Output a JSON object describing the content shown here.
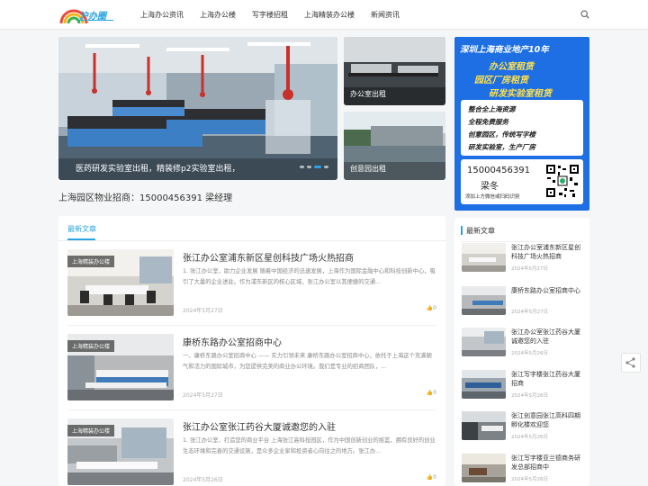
{
  "header": {
    "logo_text": "沪办圈",
    "nav": [
      "上海办公资讯",
      "上海办公楼",
      "写字楼招租",
      "上海精装办公楼",
      "新闻资讯"
    ]
  },
  "slider": {
    "caption": "医药研发实验室出租，精装修p2实验室出租，"
  },
  "side_cards": [
    {
      "label": "办公室出租"
    },
    {
      "label": "创意园出租"
    }
  ],
  "ad": {
    "headline": "深圳上海商业地产10年",
    "lines": [
      "办公室租赁",
      "园区厂房租赁",
      "研发实验室租赁"
    ],
    "body": [
      "整合全上海资源",
      "全程免费服务",
      "创意园区，传统写字楼",
      "研发实验室，生产厂房"
    ],
    "phone": "15000456391",
    "name": "梁冬",
    "wechat_hint": "添加上方微信或扫码识别"
  },
  "contact": "上海园区物业招商：15000456391 梁经理",
  "main": {
    "tab": "最新文章",
    "posts": [
      {
        "tag": "上海精装办公楼",
        "title": "张江办公室浦东新区星创科技广场火热招商",
        "excerpt": "1. 张江办公室，助力企业发展 随着中国经济的迅速发展，上海作为国际金融中心和科技创新中心，吸引了大量的企业进驻。作为浦东新区的核心区域，张江办公室以其便捷的交通...",
        "date": "2024年5月27日",
        "likes": "0"
      },
      {
        "tag": "上海精装办公楼",
        "title": "康桥东路办公室招商中心",
        "excerpt": "一、康桥东路办公室招商中心 —— 实力引领未来 康桥东路办公室招商中心，依托于上海这个充满朝气和活力的国际城市，为您提供完美的商业办公环境。我们是专业的招商团队，...",
        "date": "2024年5月27日",
        "likes": "0"
      },
      {
        "tag": "上海精装办公楼",
        "title": "张江办公室张江药谷大厦诚邀您的入驻",
        "excerpt": "1. 张江办公室，打造您的商业平台 上海张江高科技园区，作为中国创新创业的摇篮，拥有良好的创业生态环境和完善的交通设施，是众多企业家和投资者心向往之的地方。张江办...",
        "date": "2024年5月26日",
        "likes": "0"
      }
    ]
  },
  "sidebar": {
    "title": "最新文章",
    "items": [
      {
        "title": "张江办公室浦东新区星创科技广场火热招商",
        "date": "2024年5月27日"
      },
      {
        "title": "康桥东路办公室招商中心",
        "date": "2024年5月27日"
      },
      {
        "title": "张江办公室张江药谷大厦诚邀您的入驻",
        "date": "2024年5月26日"
      },
      {
        "title": "张江写字楼张江药谷大厦招商",
        "date": "2024年5月26日"
      },
      {
        "title": "张江创意园张江高科四期孵化楼欢迎您",
        "date": "2024年5月26日"
      },
      {
        "title": "张江写字楼亚兰德商务研发总部招商中",
        "date": "2024年5月26日"
      }
    ]
  },
  "colors": {
    "accent": "#2aa3e0",
    "ad_bg": "#1d6fe3",
    "ad_text": "#ffe14d"
  }
}
